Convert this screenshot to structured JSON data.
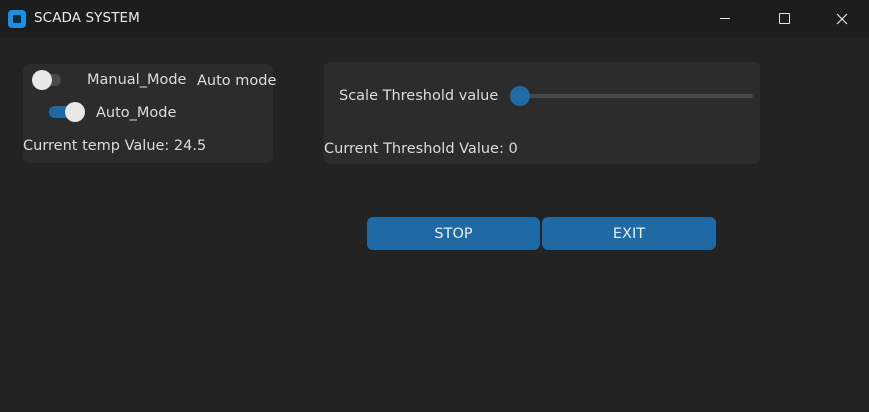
{
  "window": {
    "title": "SCADA SYSTEM",
    "controls": [
      "minimize-icon",
      "maximize-icon",
      "close-icon"
    ]
  },
  "mode_panel": {
    "manual_switch": {
      "label": "Manual_Mode",
      "on": false
    },
    "mode_status": "Auto mode",
    "auto_switch": {
      "label": "Auto_Mode",
      "on": true
    },
    "temp_text": "Current temp Value: 24.5"
  },
  "threshold_panel": {
    "slider_label": "Scale Threshold value",
    "slider_value": 0,
    "slider_min": 0,
    "slider_max": 100,
    "current_text": "Current Threshold Value: 0"
  },
  "actions": {
    "stop_label": "STOP",
    "exit_label": "EXIT"
  },
  "colors": {
    "accent": "#1f6aa5",
    "background": "#232323",
    "panel": "#2c2c2c",
    "text": "#dcdcdc"
  }
}
